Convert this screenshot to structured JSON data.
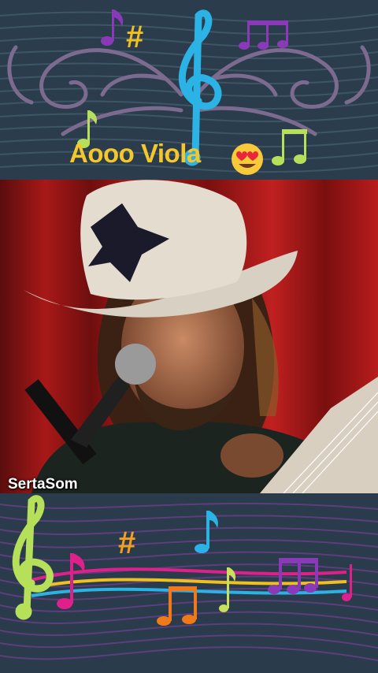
{
  "caption": {
    "text": "Aooo Viola",
    "emoji": "smiling-face-with-heart-eyes"
  },
  "video": {
    "watermark": "SertaSom"
  },
  "top_decor": {
    "symbols": [
      "eighth-note-icon",
      "sharp-icon",
      "treble-clef-icon",
      "beamed-notes-icon"
    ],
    "sharp_glyph": "#"
  },
  "bottom_decor": {
    "symbols": [
      "treble-clef-icon",
      "eighth-note-icon",
      "sharp-icon",
      "beamed-notes-icon"
    ],
    "sharp_glyph": "#"
  },
  "colors": {
    "background": "#2b3d4c",
    "caption": "#f4c72a",
    "clef_blue": "#2bb3e6",
    "clef_green": "#b6e05a",
    "pink": "#e0208a",
    "purple": "#8a3ab8",
    "orange": "#f07a1a",
    "curtain": "#a01414"
  }
}
